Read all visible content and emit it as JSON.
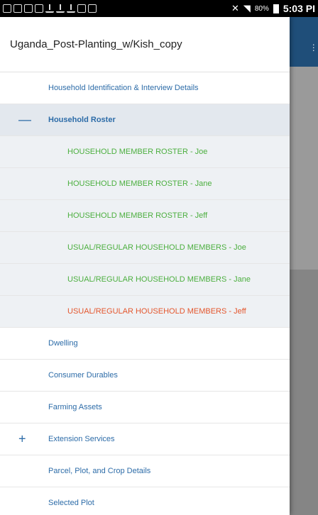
{
  "status_bar": {
    "battery": "80%",
    "time": "5:03 PI"
  },
  "drawer": {
    "title": "Uganda_Post-Planting_w/Kish_copy",
    "items": [
      {
        "label": "Household Identification & Interview Details",
        "style": "top"
      },
      {
        "label": "Household Roster",
        "style": "selected",
        "prefix": "—"
      },
      {
        "label": "HOUSEHOLD MEMBER ROSTER - Joe",
        "style": "green"
      },
      {
        "label": "HOUSEHOLD MEMBER ROSTER - Jane",
        "style": "green"
      },
      {
        "label": "HOUSEHOLD MEMBER ROSTER - Jeff",
        "style": "green"
      },
      {
        "label": "USUAL/REGULAR  HOUSEHOLD MEMBERS - Joe",
        "style": "green"
      },
      {
        "label": "USUAL/REGULAR  HOUSEHOLD MEMBERS - Jane",
        "style": "green"
      },
      {
        "label": "USUAL/REGULAR  HOUSEHOLD MEMBERS - Jeff",
        "style": "red"
      },
      {
        "label": "Dwelling",
        "style": "top"
      },
      {
        "label": "Consumer Durables",
        "style": "top"
      },
      {
        "label": "Farming Assets",
        "style": "top"
      },
      {
        "label": "Extension Services",
        "style": "top",
        "prefix": "+"
      },
      {
        "label": "Parcel, Plot, and Crop Details",
        "style": "top"
      },
      {
        "label": "Selected Plot",
        "style": "top"
      }
    ]
  },
  "colors": {
    "link_blue": "#2d6ca8",
    "complete_green": "#4caf3f",
    "error_red": "#e4572e",
    "selected_bg": "#e3e8ee",
    "app_bar": "#1f4e79"
  }
}
